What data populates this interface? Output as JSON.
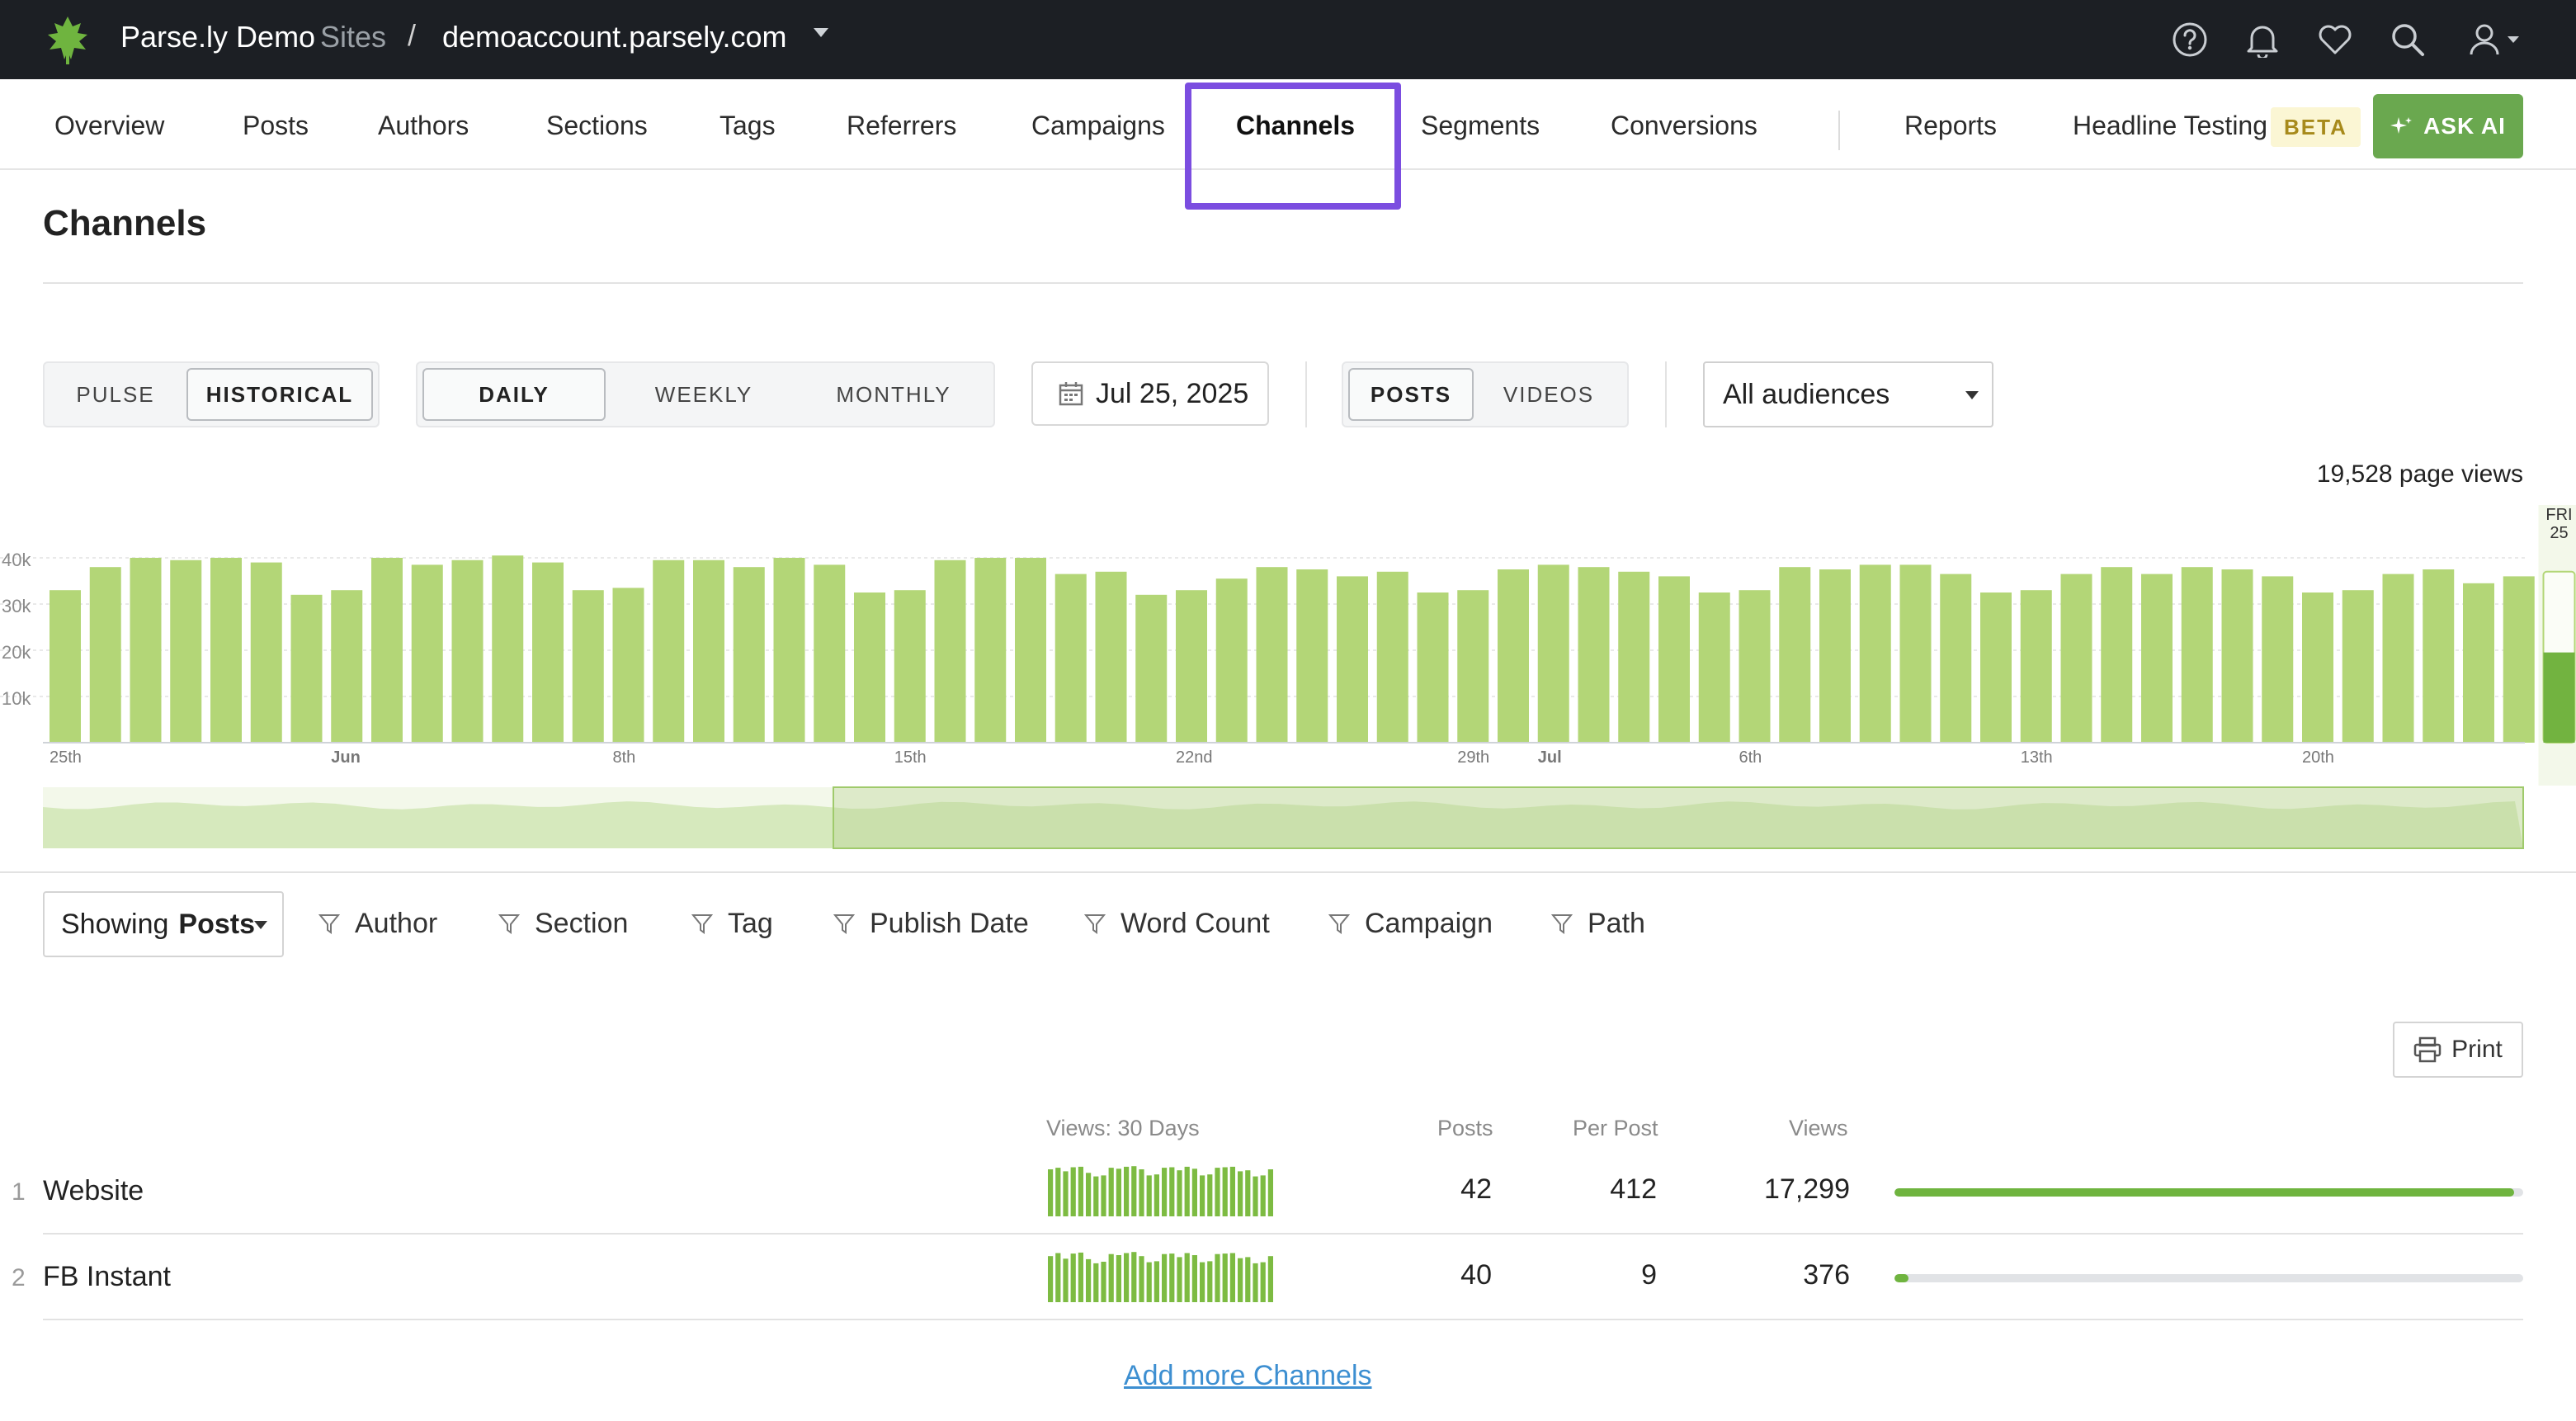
{
  "header": {
    "brand": "Parse.ly Demo",
    "sites_label": "Sites",
    "separator": "/",
    "domain": "demoaccount.parsely.com"
  },
  "nav": {
    "items": [
      "Overview",
      "Posts",
      "Authors",
      "Sections",
      "Tags",
      "Referrers",
      "Campaigns",
      "Channels",
      "Segments",
      "Conversions"
    ],
    "active": "Channels",
    "reports": "Reports",
    "headline_testing": "Headline Testing",
    "beta": "BETA",
    "ask_ai": "ASK AI"
  },
  "page": {
    "title": "Channels"
  },
  "controls": {
    "mode": {
      "pulse": "PULSE",
      "historical": "HISTORICAL",
      "selected": "HISTORICAL"
    },
    "period": {
      "daily": "DAILY",
      "weekly": "WEEKLY",
      "monthly": "MONTHLY",
      "selected": "DAILY"
    },
    "date": "Jul 25, 2025",
    "content": {
      "posts": "POSTS",
      "videos": "VIDEOS",
      "selected": "POSTS"
    },
    "audience": "All audiences"
  },
  "chart_data": {
    "type": "bar",
    "total_label": "19,528 page views",
    "y_ticks": [
      "10k",
      "20k",
      "30k",
      "40k"
    ],
    "ylim": [
      0,
      45000
    ],
    "x_tick_labels": [
      {
        "index": 0,
        "label": "25th",
        "bold": false
      },
      {
        "index": 7,
        "label": "Jun",
        "bold": true
      },
      {
        "index": 14,
        "label": "8th",
        "bold": false
      },
      {
        "index": 21,
        "label": "15th",
        "bold": false
      },
      {
        "index": 28,
        "label": "22nd",
        "bold": false
      },
      {
        "index": 35,
        "label": "29th",
        "bold": false
      },
      {
        "index": 37,
        "label": "Jul",
        "bold": true
      },
      {
        "index": 42,
        "label": "6th",
        "bold": false
      },
      {
        "index": 49,
        "label": "13th",
        "bold": false
      },
      {
        "index": 56,
        "label": "20th",
        "bold": false
      }
    ],
    "values": [
      33000,
      38000,
      40000,
      39500,
      40000,
      39000,
      32000,
      33000,
      40000,
      38500,
      39500,
      40500,
      39000,
      33000,
      33500,
      39500,
      39500,
      38000,
      40000,
      38500,
      32500,
      33000,
      39500,
      40000,
      40000,
      36500,
      37000,
      32000,
      33000,
      35500,
      38000,
      37500,
      36000,
      37000,
      32500,
      33000,
      37500,
      38500,
      38000,
      37000,
      36000,
      32500,
      33000,
      38000,
      37500,
      38500,
      38500,
      36500,
      32500,
      33000,
      36500,
      38000,
      36500,
      38000,
      37500,
      36000,
      32500,
      33000,
      36500,
      37500,
      34500,
      36000
    ],
    "current": {
      "label_day": "FRI",
      "label_date": "25",
      "value": 19528,
      "projected": 37000
    },
    "colors": {
      "bar": "#b3d677",
      "current": "#72b340",
      "brush": "#cfe4af"
    }
  },
  "filters": {
    "showing_prefix": "Showing",
    "showing_value": "Posts",
    "items": [
      "Author",
      "Section",
      "Tag",
      "Publish Date",
      "Word Count",
      "Campaign",
      "Path"
    ]
  },
  "print_label": "Print",
  "table": {
    "headers": {
      "views_30": "Views: 30 Days",
      "posts": "Posts",
      "per_post": "Per Post",
      "views": "Views"
    },
    "rows": [
      {
        "rank": "1",
        "name": "Website",
        "posts": "42",
        "per_post": "412",
        "views": "17,299",
        "share": 0.985
      },
      {
        "rank": "2",
        "name": "FB Instant",
        "posts": "40",
        "per_post": "9",
        "views": "376",
        "share": 0.022
      }
    ]
  },
  "add_more": "Add more Channels"
}
